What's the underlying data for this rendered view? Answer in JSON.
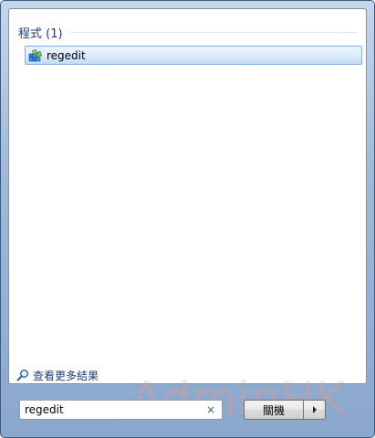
{
  "programs_section": {
    "title": "程式 (1)",
    "items": [
      {
        "label": "regedit",
        "icon": "registry-editor-icon"
      }
    ]
  },
  "more_results": {
    "label": "查看更多結果",
    "icon": "search-icon"
  },
  "search": {
    "value": "regedit",
    "clear_icon": "×"
  },
  "shutdown": {
    "label": "關機",
    "options_icon": "arrow-right-icon"
  },
  "watermark": "AdminHK",
  "colors": {
    "section_title": "#1e3c78",
    "highlight_border": "#84acdd",
    "frame": "#9fb9d8"
  }
}
